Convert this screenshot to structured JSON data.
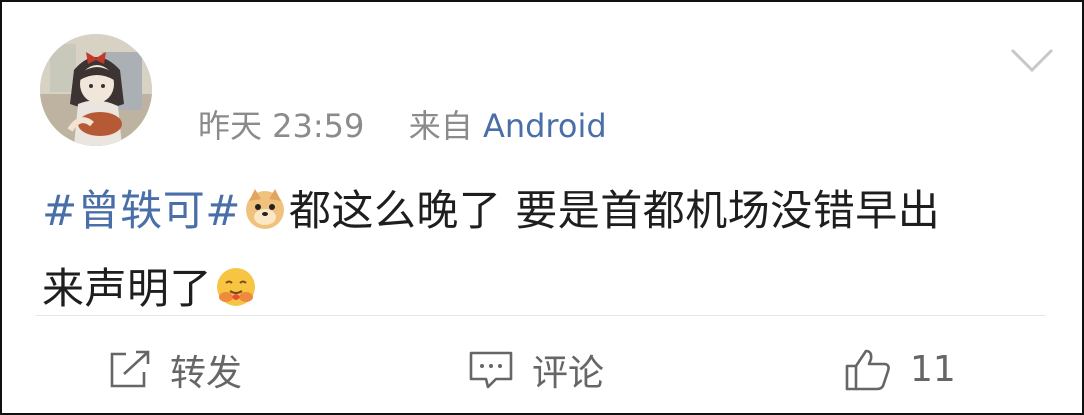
{
  "post": {
    "timestamp": "昨天 23:59",
    "source_prefix": "来自",
    "source": "Android",
    "topic": "#曾轶可#",
    "text_line1": "都这么晚了  要是首都机场没错早出",
    "text_line2": "来声明了",
    "emoji_1": "doge-emoji",
    "emoji_2": "hug-emoji"
  },
  "actions": {
    "repost_label": "转发",
    "comment_label": "评论",
    "like_count": "11"
  },
  "icons": {
    "menu": "chevron-down-icon",
    "repost": "share-icon",
    "comment": "comment-icon",
    "like": "thumbs-up-icon"
  },
  "colors": {
    "link": "#4a6fa8",
    "meta": "#8b8b8b",
    "action": "#666666"
  }
}
